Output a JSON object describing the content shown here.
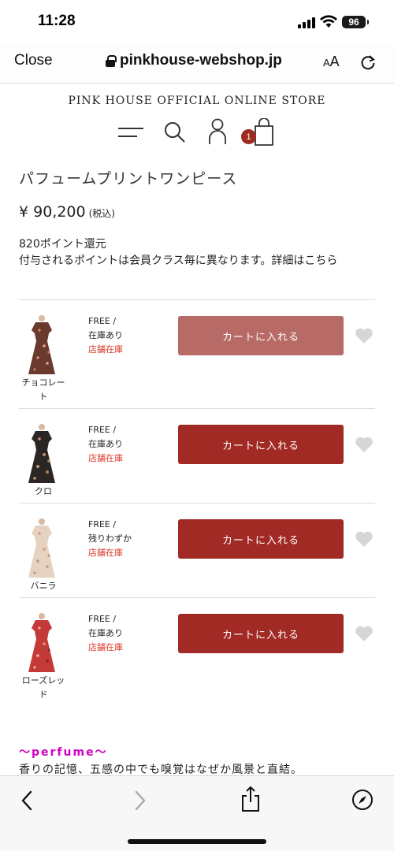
{
  "status_bar": {
    "time": "11:28",
    "battery": "96"
  },
  "browser": {
    "close_label": "Close",
    "url": "pinkhouse-webshop.jp",
    "aa_small": "A",
    "aa_big": "A"
  },
  "store": {
    "title": "PINK HOUSE OFFICIAL ONLINE STORE",
    "cart_count": "1"
  },
  "product": {
    "name": "パフュームプリントワンピース",
    "price": "¥ 90,200",
    "tax_label": "(税込)",
    "points_line1": "820ポイント還元",
    "points_line2": "付与されるポイントは会員クラス毎に異なります。詳細はこちら"
  },
  "variants": [
    {
      "color_line1": "チョコレー",
      "color_line2": "ト",
      "size": "FREE /",
      "stock": "在庫あり",
      "shop": "店舗在庫",
      "button": "カートに入れる",
      "button_color": "#b86a66"
    },
    {
      "color_line1": "クロ",
      "color_line2": "",
      "size": "FREE /",
      "stock": "在庫あり",
      "shop": "店舗在庫",
      "button": "カートに入れる",
      "button_color": "#a12b24"
    },
    {
      "color_line1": "バニラ",
      "color_line2": "",
      "size": "FREE /",
      "stock": "残りわずか",
      "shop": "店舗在庫",
      "button": "カートに入れる",
      "button_color": "#a12b24"
    },
    {
      "color_line1": "ローズレッ",
      "color_line2": "ド",
      "size": "FREE /",
      "stock": "在庫あり",
      "shop": "店舗在庫",
      "button": "カートに入れる",
      "button_color": "#a12b24"
    }
  ],
  "perfume": {
    "title": "〜perfume〜",
    "text": "香りの記憶、五感の中でも嗅覚はなぜか風景と直結。"
  },
  "colors": {
    "accent_red": "#a12b24",
    "accent_red_light": "#b86a66",
    "shop_stock_red": "#d93a2b",
    "perfume_magenta": "#d300c2"
  },
  "icons": [
    "menu-icon",
    "search-icon",
    "user-icon",
    "shopping-bag-icon",
    "heart-icon",
    "back-icon",
    "forward-icon",
    "share-icon",
    "compass-icon",
    "lock-icon",
    "reload-icon"
  ]
}
